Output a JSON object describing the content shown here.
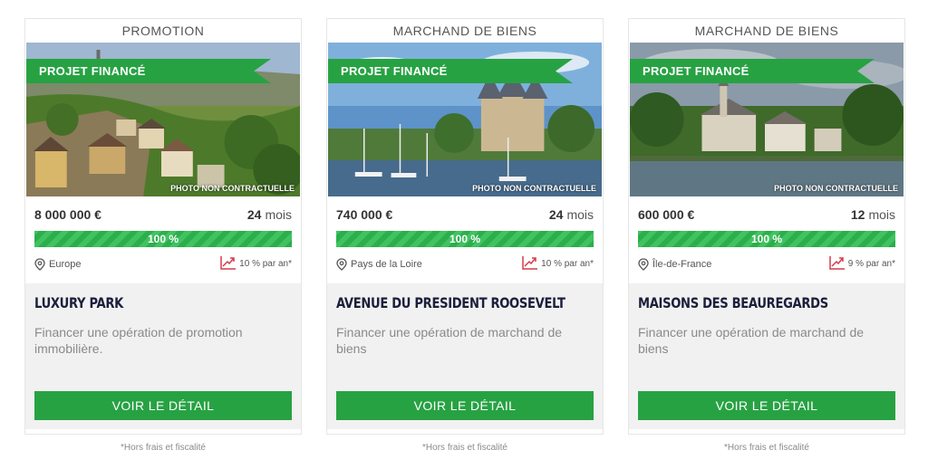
{
  "colors": {
    "accent": "#27a243",
    "title": "#1b1f3b",
    "rate_icon": "#d63a4a"
  },
  "cards": [
    {
      "type": "PROMOTION",
      "badge": "PROJET FINANCÉ",
      "photo_note": "PHOTO NON CONTRACTUELLE",
      "photo_scene": "luxembourg-old-town",
      "amount": "8 000 000 €",
      "duration_value": "24",
      "duration_unit": "mois",
      "progress_label": "100 %",
      "progress_percent": 100,
      "location": "Europe",
      "rate": "10 % par an*",
      "title": "LUXURY PARK",
      "description": "Financer une opération de promotion immobilière.",
      "cta": "VOIR LE DÉTAIL",
      "footnote": "*Hors frais et fiscalité"
    },
    {
      "type": "MARCHAND DE BIENS",
      "badge": "PROJET FINANCÉ",
      "photo_note": "PHOTO NON CONTRACTUELLE",
      "photo_scene": "harbor-castle",
      "amount": "740 000 €",
      "duration_value": "24",
      "duration_unit": "mois",
      "progress_label": "100 %",
      "progress_percent": 100,
      "location": "Pays de la Loire",
      "rate": "10 % par an*",
      "title": "AVENUE DU PRESIDENT ROOSEVELT",
      "description": "Financer une opération de marchand de biens",
      "cta": "VOIR LE DÉTAIL",
      "footnote": "*Hors frais et fiscalité"
    },
    {
      "type": "MARCHAND DE BIENS",
      "badge": "PROJET FINANCÉ",
      "photo_note": "PHOTO NON CONTRACTUELLE",
      "photo_scene": "riverside-village",
      "amount": "600 000 €",
      "duration_value": "12",
      "duration_unit": "mois",
      "progress_label": "100 %",
      "progress_percent": 100,
      "location": "Île-de-France",
      "rate": "9 % par an*",
      "title": "MAISONS DES BEAUREGARDS",
      "description": "Financer une opération de marchand de biens",
      "cta": "VOIR LE DÉTAIL",
      "footnote": "*Hors frais et fiscalité"
    }
  ]
}
